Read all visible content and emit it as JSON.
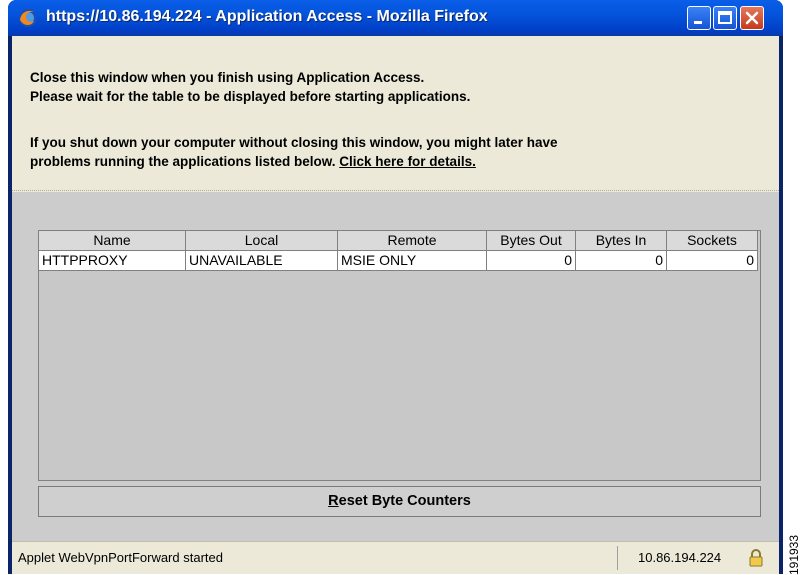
{
  "window": {
    "title": "https://10.86.194.224 - Application Access - Mozilla Firefox",
    "icon": "firefox-icon",
    "controls": [
      "minimize-icon",
      "maximize-icon",
      "close-icon"
    ]
  },
  "info": {
    "line1": "Close this window when you finish using Application Access.",
    "line2": "Please wait for the table to be displayed before starting applications.",
    "line3": "If you shut down your computer without closing this window, you might later have",
    "line4_text": "problems running the applications listed below. ",
    "details_link": "Click here for details."
  },
  "table": {
    "columns": [
      "Name",
      "Local",
      "Remote",
      "Bytes Out",
      "Bytes In",
      "Sockets"
    ],
    "rows": [
      [
        "HTTPPROXY",
        "UNAVAILABLE",
        "MSIE ONLY",
        "0",
        "0",
        "0"
      ]
    ]
  },
  "reset_button": {
    "mnemonic": "R",
    "rest": "eset Byte Counters"
  },
  "status": {
    "text": "Applet WebVpnPortForward started",
    "ip": "10.86.194.224",
    "lock_icon": "lock-icon"
  },
  "figure_id": "191933",
  "colors": {
    "titlebar": "#0553db",
    "client_bg": "#ece9d8",
    "applet_bg": "#cccccc",
    "close_button": "#c43a1c"
  }
}
